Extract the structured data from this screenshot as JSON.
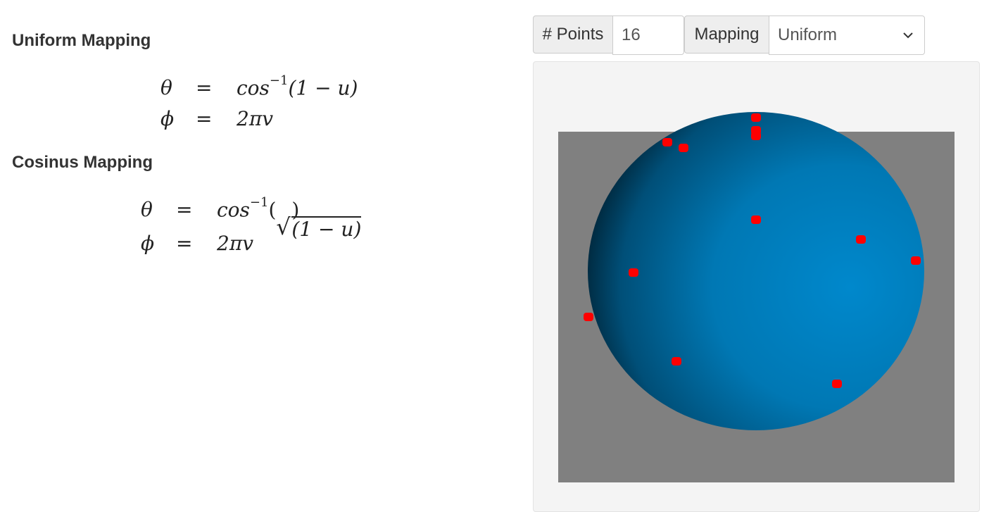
{
  "uniform_section": {
    "heading": "Uniform Mapping",
    "equations": [
      {
        "lhs": "θ",
        "eq": "=",
        "func": "cos",
        "sup": "−1",
        "arg": "(1 − u)"
      },
      {
        "lhs": "ϕ",
        "eq": "=",
        "rhs": "2πv"
      }
    ]
  },
  "cosinus_section": {
    "heading": "Cosinus Mapping",
    "equations": [
      {
        "lhs": "θ",
        "eq": "=",
        "func": "cos",
        "sup": "−1",
        "open": "(",
        "radical": "√",
        "radicand": "(1 − u)",
        "close": ")"
      },
      {
        "lhs": "ϕ",
        "eq": "=",
        "rhs": "2πv"
      }
    ]
  },
  "controls": {
    "points_label": "# Points",
    "points_value": "16",
    "mapping_label": "Mapping",
    "mapping_selected": "Uniform"
  },
  "viewport": {
    "background_color": "#808080",
    "sphere_color": "#0088cc",
    "point_color": "#ff0000",
    "visible_points": 12
  }
}
